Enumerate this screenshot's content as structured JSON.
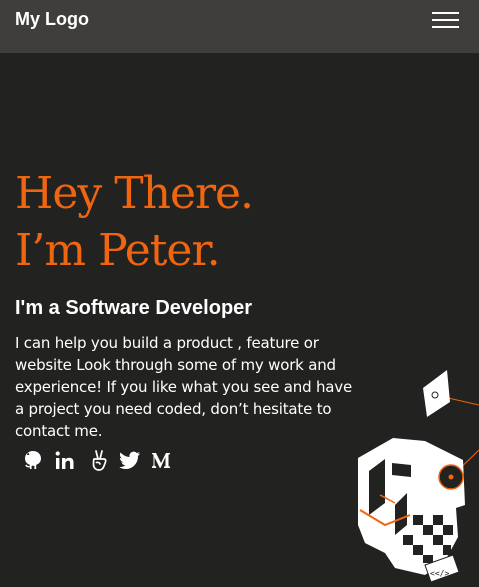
{
  "nav": {
    "logo": "My Logo"
  },
  "hero": {
    "title_line1": "Hey There.",
    "title_line2": "I’m Peter.",
    "subtitle": "I'm a Software Developer",
    "intro": "I can help you build a product , feature or website Look through some of my work and experience! If you like what you see and have a project you need coded, don’t hesitate to contact me."
  },
  "socials": [
    {
      "icon": "github-icon"
    },
    {
      "icon": "linkedin-icon"
    },
    {
      "icon": "angellist-icon"
    },
    {
      "icon": "twitter-icon"
    },
    {
      "icon": "medium-icon"
    }
  ],
  "illustration": {
    "code_tag": "<</>"
  },
  "colors": {
    "background": "#222221",
    "navbar": "#3f3e3d",
    "accent": "#f0650f",
    "text": "#ffffff"
  }
}
